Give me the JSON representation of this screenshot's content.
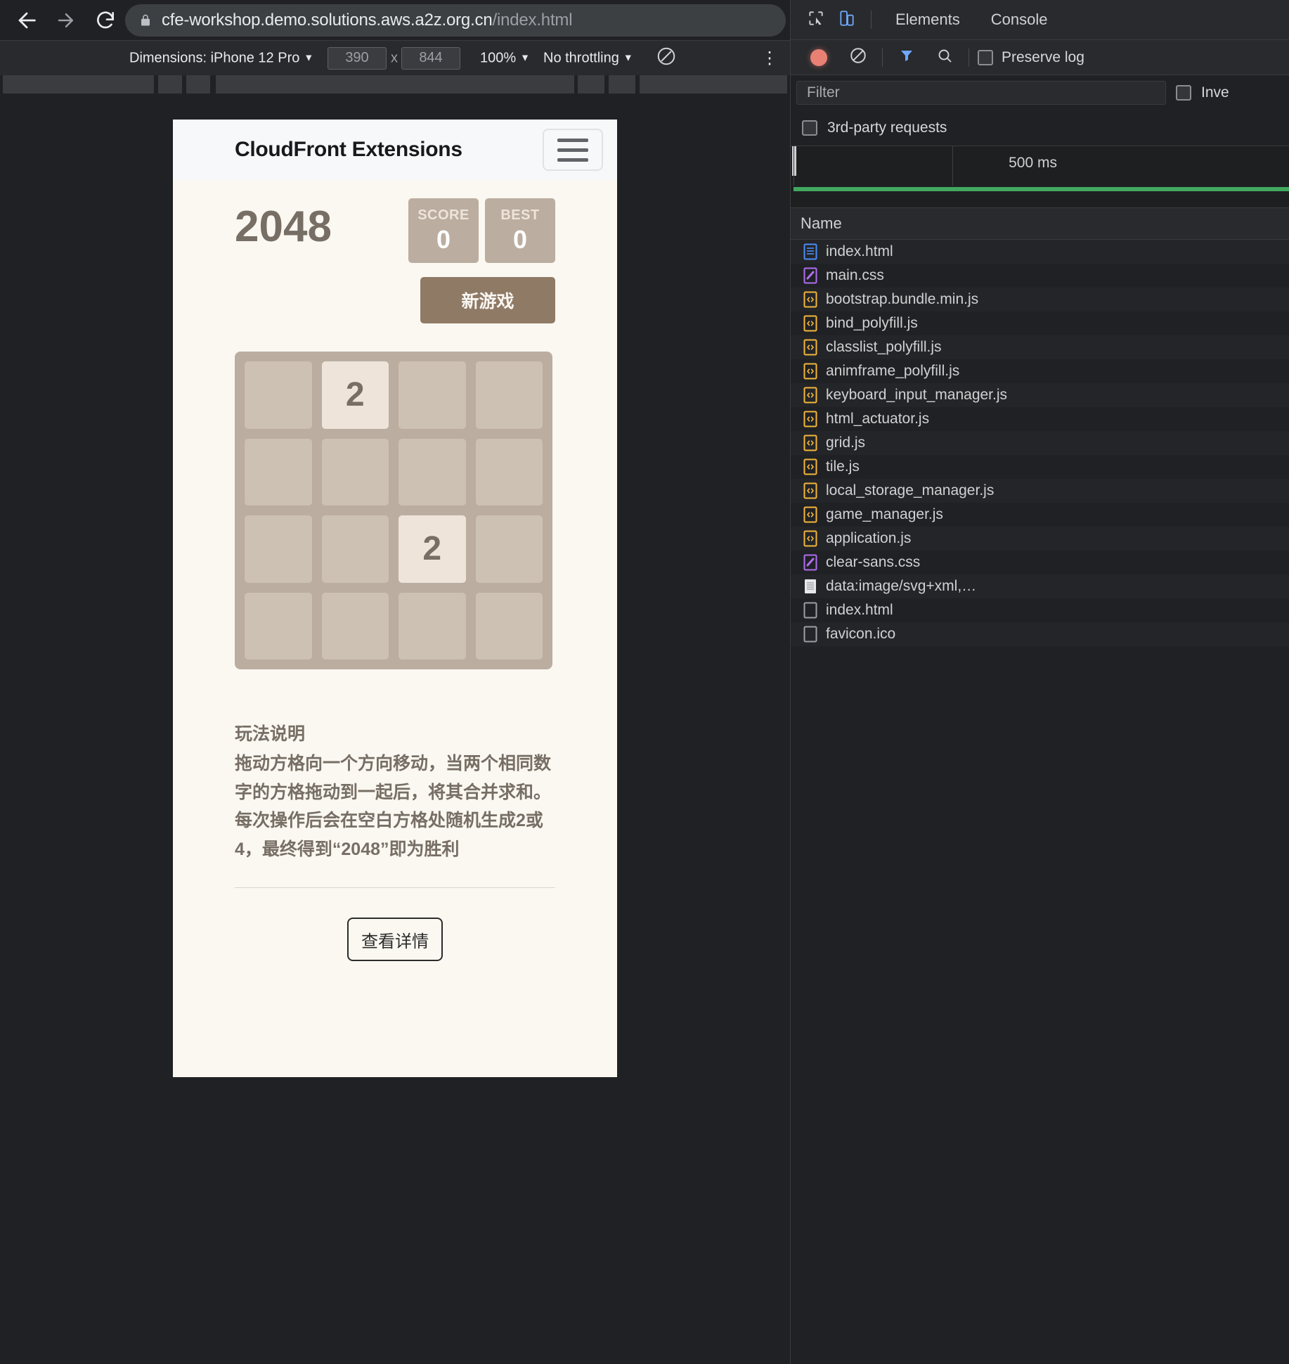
{
  "browser": {
    "back_icon": "back-arrow-icon",
    "forward_icon": "forward-arrow-icon",
    "reload_icon": "reload-icon",
    "lock_icon": "lock-icon",
    "url_host": "cfe-workshop.demo.solutions.aws.a2z.org.cn",
    "url_path": "/index.html"
  },
  "device_toolbar": {
    "dimensions_label": "Dimensions: iPhone 12 Pro",
    "width": "390",
    "times": "x",
    "height": "844",
    "zoom": "100%",
    "throttling": "No throttling",
    "rotate_icon": "rotate-device-icon",
    "kebab_icon": "more-options-icon"
  },
  "page": {
    "header": {
      "title": "CloudFront Extensions",
      "menu_icon": "hamburger-menu-icon"
    },
    "game": {
      "logo": "2048",
      "score_label": "SCORE",
      "score_value": "0",
      "best_label": "BEST",
      "best_value": "0",
      "new_game_label": "新游戏",
      "tiles": [
        [
          "",
          "2",
          "",
          ""
        ],
        [
          "",
          "",
          "",
          ""
        ],
        [
          "",
          "",
          "2",
          ""
        ],
        [
          "",
          "",
          "",
          ""
        ]
      ]
    },
    "explain": {
      "title": "玩法说明",
      "line1": "拖动方格向一个方向移动，当两个相同数",
      "line2": "字的方格拖动到一起后，将其合并求和。",
      "line3": "每次操作后会在空白方格处随机生成2或",
      "line4": "4，最终得到“2048”即为胜利"
    },
    "detail_button": "查看详情"
  },
  "devtools": {
    "inspect_icon": "inspect-element-icon",
    "device_toggle_icon": "device-toolbar-icon",
    "tabs": [
      "Elements",
      "Console"
    ],
    "record_icon": "record-button-icon",
    "clear_icon": "clear-network-log-icon",
    "filter_icon": "filter-icon",
    "search_icon": "search-icon",
    "preserve_log_label": "Preserve log",
    "filter_placeholder": "Filter",
    "invert_label": "Inve",
    "third_party_label": "3rd-party requests",
    "timeline_label": "500 ms",
    "column_name": "Name",
    "requests": [
      {
        "name": "index.html",
        "icon": "document-icon",
        "type": "doc"
      },
      {
        "name": "main.css",
        "icon": "stylesheet-icon",
        "type": "css"
      },
      {
        "name": "bootstrap.bundle.min.js",
        "icon": "script-icon",
        "type": "js"
      },
      {
        "name": "bind_polyfill.js",
        "icon": "script-icon",
        "type": "js"
      },
      {
        "name": "classlist_polyfill.js",
        "icon": "script-icon",
        "type": "js"
      },
      {
        "name": "animframe_polyfill.js",
        "icon": "script-icon",
        "type": "js"
      },
      {
        "name": "keyboard_input_manager.js",
        "icon": "script-icon",
        "type": "js"
      },
      {
        "name": "html_actuator.js",
        "icon": "script-icon",
        "type": "js"
      },
      {
        "name": "grid.js",
        "icon": "script-icon",
        "type": "js"
      },
      {
        "name": "tile.js",
        "icon": "script-icon",
        "type": "js"
      },
      {
        "name": "local_storage_manager.js",
        "icon": "script-icon",
        "type": "js"
      },
      {
        "name": "game_manager.js",
        "icon": "script-icon",
        "type": "js"
      },
      {
        "name": "application.js",
        "icon": "script-icon",
        "type": "js"
      },
      {
        "name": "clear-sans.css",
        "icon": "stylesheet-icon",
        "type": "css"
      },
      {
        "name": "data:image/svg+xml,…",
        "icon": "image-icon",
        "type": "img"
      },
      {
        "name": "index.html",
        "icon": "other-icon",
        "type": "other"
      },
      {
        "name": "favicon.ico",
        "icon": "other-icon",
        "type": "other"
      }
    ]
  },
  "colors": {
    "grid_bg": "#bbada0",
    "cell_bg": "#cdc1b4",
    "tile_bg": "#eee4da",
    "tile_text": "#776e65",
    "new_game": "#8f7a66",
    "page_bg": "#faf8f1",
    "devtools_bg": "#202124",
    "timeline_green": "#41a85f"
  }
}
